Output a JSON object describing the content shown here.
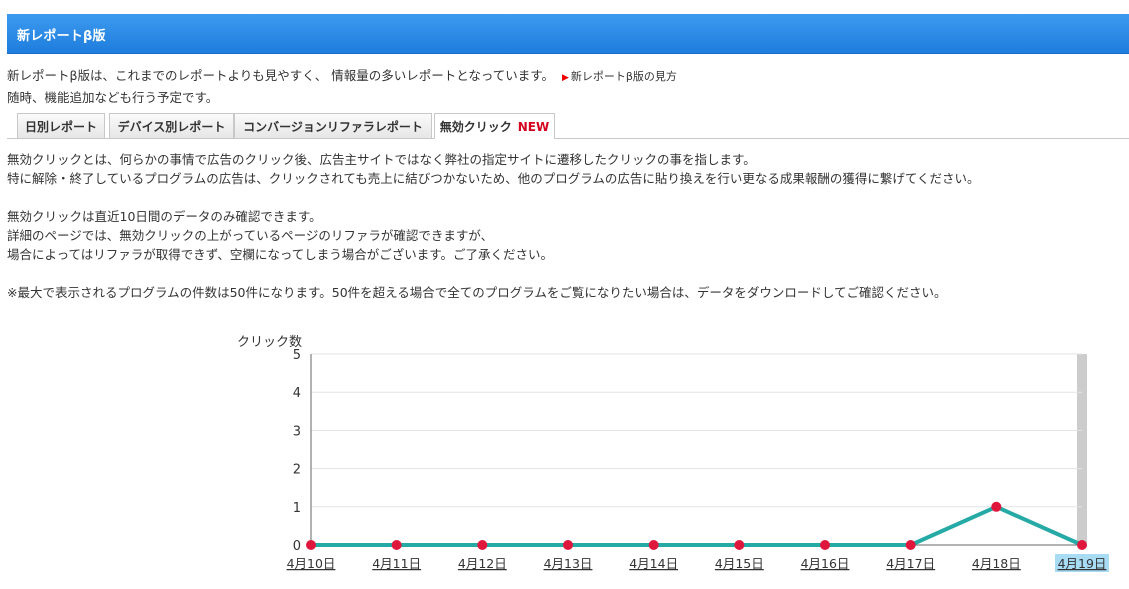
{
  "header": {
    "title": "新レポートβ版"
  },
  "intro": {
    "line1": "新レポートβ版は、これまでのレポートよりも見やすく、 情報量の多いレポートとなっています。",
    "guide_link": "新レポートβ版の見方",
    "line2": "随時、機能追加なども行う予定です。"
  },
  "tabs": [
    {
      "label": "日別レポート",
      "active": false
    },
    {
      "label": "デバイス別レポート",
      "active": false
    },
    {
      "label": "コンバージョンリファラレポート",
      "active": false
    },
    {
      "label": "無効クリック",
      "badge": "NEW",
      "active": true
    }
  ],
  "description": {
    "p1": "無効クリックとは、何らかの事情で広告のクリック後、広告主サイトではなく弊社の指定サイトに遷移したクリックの事を指します。",
    "p2": "特に解除・終了しているプログラムの広告は、クリックされても売上に結びつかないため、他のプログラムの広告に貼り換えを行い更なる成果報酬の獲得に繋げてください。",
    "p3": "無効クリックは直近10日間のデータのみ確認できます。",
    "p4": "詳細のページでは、無効クリックの上がっているページのリファラが確認できますが、",
    "p5": "場合によってはリファラが取得できず、空欄になってしまう場合がございます。ご了承ください。",
    "note": "※最大で表示されるプログラムの件数は50件になります。50件を超える場合で全てのプログラムをご覧になりたい場合は、データをダウンロードしてご確認ください。"
  },
  "chart_data": {
    "type": "line",
    "title": "",
    "xlabel": "",
    "ylabel": "クリック数",
    "categories": [
      "4月10日",
      "4月11日",
      "4月12日",
      "4月13日",
      "4月14日",
      "4月15日",
      "4月16日",
      "4月17日",
      "4月18日",
      "4月19日"
    ],
    "series": [
      {
        "values": [
          0,
          0,
          0,
          0,
          0,
          0,
          0,
          0,
          1,
          0
        ]
      }
    ],
    "ylim": [
      0,
      5
    ],
    "yticks": [
      0,
      1,
      2,
      3,
      4,
      5
    ],
    "grid": true,
    "highlighted_category": "4月19日",
    "colors": {
      "line": "#26aaa6",
      "point": "#e0173c",
      "highlight_bar": "#cccccc",
      "highlight_label": "#a8dcf5"
    }
  }
}
